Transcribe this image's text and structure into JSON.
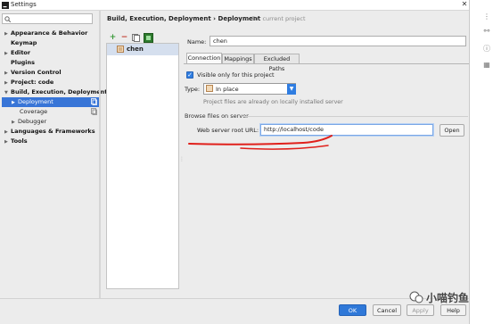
{
  "window": {
    "title": "Settings"
  },
  "search": {
    "placeholder": ""
  },
  "sidebar": {
    "items": [
      {
        "label": "Appearance & Behavior",
        "expandable": true
      },
      {
        "label": "Keymap",
        "expandable": false
      },
      {
        "label": "Editor",
        "expandable": true
      },
      {
        "label": "Plugins",
        "expandable": false
      },
      {
        "label": "Version Control",
        "expandable": true
      },
      {
        "label": "Project: code",
        "expandable": true
      },
      {
        "label": "Build, Execution, Deployment",
        "expandable": true
      }
    ],
    "children": [
      {
        "label": "Deployment",
        "selected": true
      },
      {
        "label": "Coverage",
        "selected": false
      },
      {
        "label": "Debugger",
        "selected": false
      }
    ],
    "items_after": [
      {
        "label": "Languages & Frameworks",
        "expandable": true
      },
      {
        "label": "Tools",
        "expandable": true
      }
    ]
  },
  "breadcrumb": {
    "path": "Build, Execution, Deployment › Deployment",
    "scope": "For current project"
  },
  "servers": {
    "items": [
      "chen"
    ]
  },
  "form": {
    "name_label": "Name:",
    "name_value": "chen",
    "tabs": [
      "Connection",
      "Mappings",
      "Excluded Paths"
    ],
    "active_tab": "Connection",
    "visible_only_label": "Visible only for this project",
    "visible_only_checked": true,
    "type_label": "Type:",
    "type_value": "In place",
    "type_hint": "Project files are already on locally installed server",
    "browse_section": "Browse files on server",
    "url_label": "Web server root URL:",
    "url_value": "http://localhost/code",
    "open_button": "Open"
  },
  "buttons": {
    "ok": "OK",
    "cancel": "Cancel",
    "apply": "Apply",
    "help": "Help"
  },
  "watermark": {
    "text": "小喵钓鱼"
  },
  "colors": {
    "accent": "#2f78d8",
    "selection": "#3875d7",
    "annotation": "#e0201b"
  }
}
